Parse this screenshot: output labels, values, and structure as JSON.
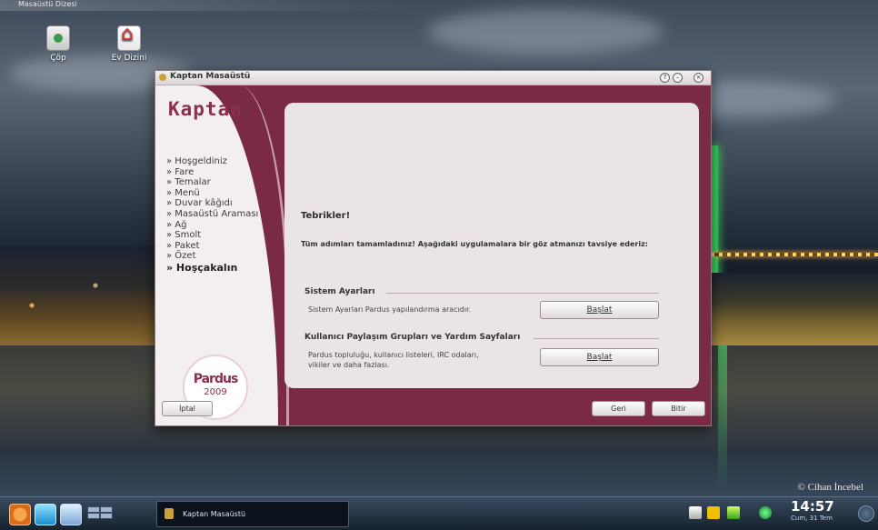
{
  "desktop": {
    "top_label": "Masaüstü Dizesi",
    "icons": [
      {
        "label": "Çöp",
        "icon": "trash-icon"
      },
      {
        "label": "Ev Dizini",
        "icon": "home-folder-icon"
      }
    ],
    "copyright": "© Cihan İncebel"
  },
  "window": {
    "title": "Kaptan Masaüstü",
    "logo": "Kaptan",
    "nav": [
      "» Hoşgeldiniz",
      "» Fare",
      "» Temalar",
      "» Menü",
      "» Duvar kâğıdı",
      "» Masaüstü Araması",
      "» Ağ",
      "» Smolt",
      "» Paket",
      "» Özet",
      "» Hoşçakalın"
    ],
    "pardus_logo": {
      "name": "Pardus",
      "year": "2009"
    },
    "content": {
      "heading": "Tebrikler!",
      "message": "Tüm adımları tamamladınız! Aşağıdaki uygulamalara bir göz atmanızı tavsiye ederiz:",
      "groups": [
        {
          "title": "Sistem Ayarları",
          "description": "Sistem Ayarları Pardus yapılandırma aracıdır.",
          "button": "Başlat"
        },
        {
          "title": "Kullanıcı Paylaşım Grupları ve Yardım Sayfaları",
          "description": "Pardus topluluğu, kullanıcı listeleri, IRC odaları, vikiler ve daha fazlası.",
          "button": "Başlat"
        }
      ]
    },
    "buttons": {
      "cancel": "İptal",
      "back": "Geri",
      "finish": "Bitir"
    }
  },
  "taskbar": {
    "task_label": "Kaptan Masaüstü",
    "time": "14:57",
    "date": "Cum, 31 Tem"
  },
  "colors": {
    "accent": "#7a2a45",
    "panel": "#ebe4e6"
  }
}
